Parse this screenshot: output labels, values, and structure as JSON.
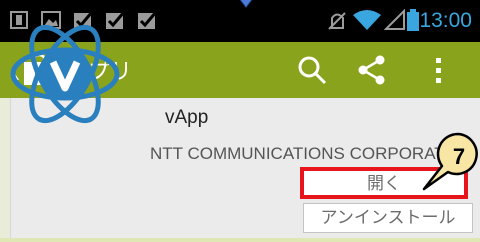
{
  "status_bar": {
    "icons": [
      "notification-square-icon",
      "image-icon",
      "checkbox-icon",
      "checkbox-icon",
      "checkbox-icon"
    ],
    "right_icons": [
      "alarm-icon",
      "wifi-icon",
      "signal-icon",
      "battery-icon"
    ],
    "time": "13:00"
  },
  "action_bar": {
    "title": "アプリ",
    "icons": [
      "back-chevron-icon",
      "play-store-bag-icon",
      "search-icon",
      "share-icon",
      "overflow-menu-icon"
    ]
  },
  "app": {
    "name": "vApp",
    "developer": "NTT COMMUNICATIONS CORPORATI",
    "open_label": "開く",
    "uninstall_label": "アンインストール"
  },
  "callout": {
    "number": "7"
  },
  "colors": {
    "action_bar": "#8aa31c",
    "status_bar": "#000000",
    "highlight": "#e8141c",
    "callout": "#f8e6a5",
    "app_icon": "#2a7fbf"
  }
}
